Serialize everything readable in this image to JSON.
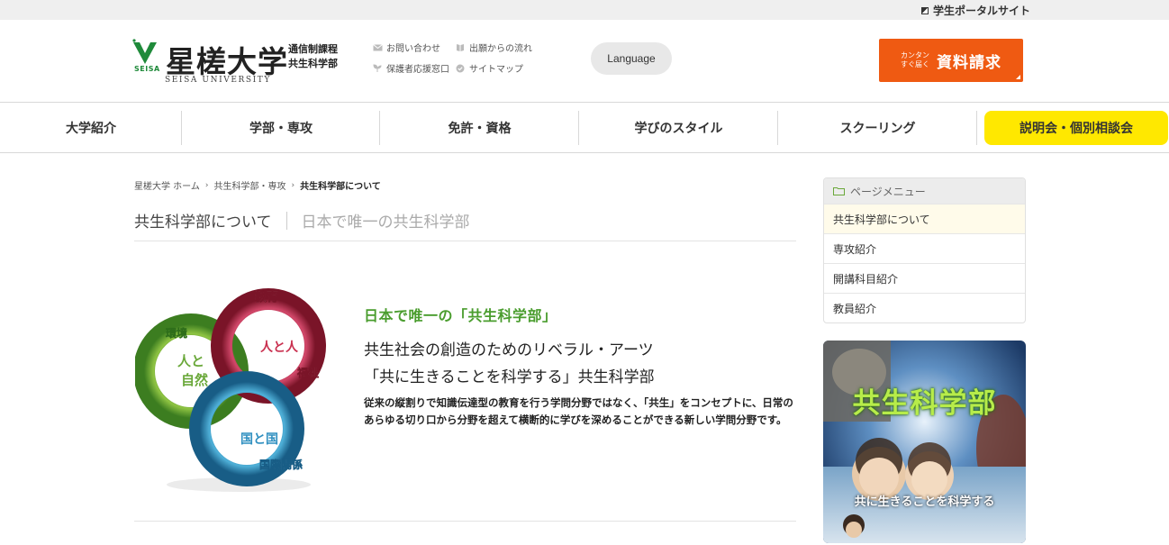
{
  "topbar": {
    "portal_link": "学生ポータルサイト"
  },
  "header": {
    "logo_jp": "星槎大学",
    "logo_mark_text": "SEISA",
    "logo_en": "SEISA UNIVERSITY",
    "logo_sub_line1": "通信制課程",
    "logo_sub_line2": "共生科学部",
    "links": [
      {
        "label": "お問い合わせ",
        "icon": "mail-icon"
      },
      {
        "label": "出願からの流れ",
        "icon": "book-icon"
      },
      {
        "label": "保護者応援窓口",
        "icon": "sprout-icon"
      },
      {
        "label": "サイトマップ",
        "icon": "check-circle-icon"
      }
    ],
    "language_button": "Language",
    "request_small_1": "カンタン",
    "request_small_2": "すぐ届く",
    "request_label": "資料請求"
  },
  "nav": {
    "items": [
      {
        "label": "大学紹介"
      },
      {
        "label": "学部・専攻"
      },
      {
        "label": "免許・資格"
      },
      {
        "label": "学びのスタイル"
      },
      {
        "label": "スクーリング"
      },
      {
        "label": "説明会・個別相談会"
      }
    ]
  },
  "breadcrumb": {
    "items": [
      "星槎大学 ホーム",
      "共生科学部・専攻",
      "共生科学部について"
    ],
    "separator": "›"
  },
  "page": {
    "title": "共生科学部について",
    "subtitle": "日本で唯一の共生科学部",
    "rings": {
      "top": "教育",
      "top_inner": "人と人",
      "right": "福祉",
      "left": "環境",
      "left_inner_1": "人と",
      "left_inner_2": "自然",
      "bottom_inner": "国と国",
      "bottom": "国際関係"
    },
    "lead_green": "日本で唯一の「共生科学部」",
    "lead_line1": "共生社会の創造のためのリベラル・アーツ",
    "lead_line2": "「共に生きることを科学する」共生科学部",
    "description": "従来の縦割りで知識伝達型の教育を行う学問分野ではなく、「共生」をコンセプトに、日常のあらゆる切り口から分野を超えて横断的に学びを深めることができる新しい学問分野です。"
  },
  "sidebar": {
    "menu_title": "ページメニュー",
    "items": [
      {
        "label": "共生科学部について",
        "active": true
      },
      {
        "label": "専攻紹介"
      },
      {
        "label": "開講科目紹介"
      },
      {
        "label": "教員紹介"
      }
    ],
    "banner_title": "共生科学部",
    "banner_sub": "共に生きることを科学する"
  },
  "colors": {
    "accent_orange": "#ef5a12",
    "accent_yellow": "#ffe800",
    "accent_green": "#4a9d2e"
  }
}
